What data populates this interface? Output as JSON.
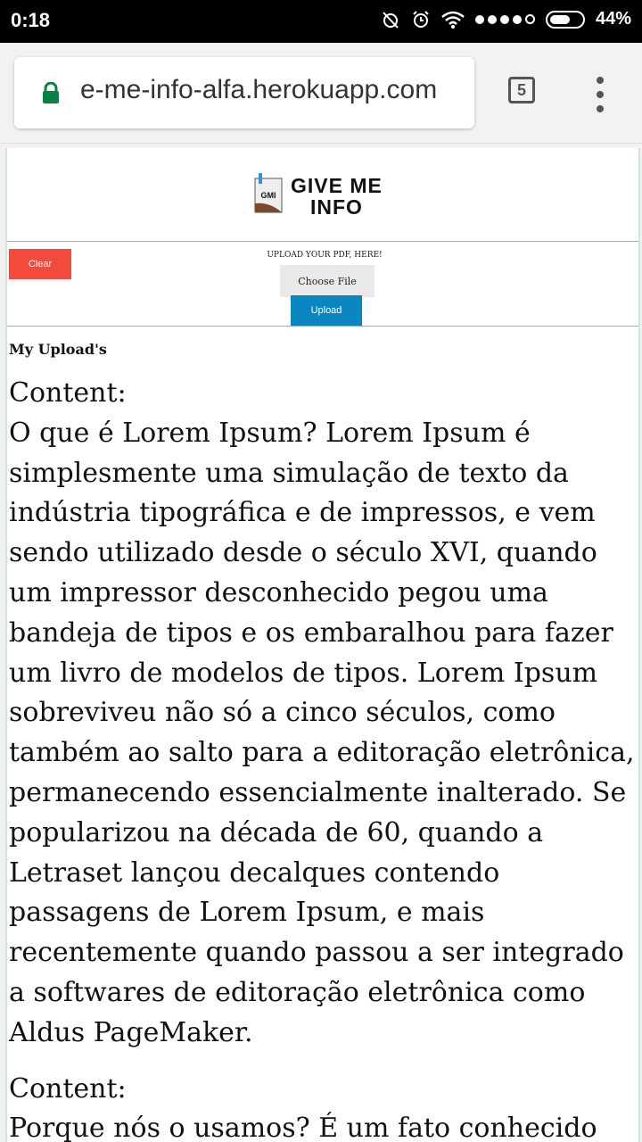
{
  "status_bar": {
    "time": "0:18",
    "battery": "44%"
  },
  "browser": {
    "url": "e-me-info-alfa.herokuapp.com",
    "tab_count": "5"
  },
  "logo": {
    "line1": "GIVE ME",
    "line2": "INFO",
    "badge": "GMI"
  },
  "upload": {
    "clear_label": "Clear",
    "prompt": "UPLOAD YOUR PDF, HERE!",
    "choose_label": "Choose File",
    "upload_label": "Upload"
  },
  "uploads": {
    "title": "My Upload's",
    "items": [
      {
        "label": "Content:",
        "text": "O que é Lorem Ipsum? Lorem Ipsum é simplesmente uma simulação de texto da indústria tipográfica e de impressos, e vem sendo utilizado desde o século XVI, quando um impressor desconhecido pegou uma bandeja de tipos e os embaralhou para fazer um livro de modelos de tipos. Lorem Ipsum sobreviveu não só a cinco séculos, como também ao salto para a editoração eletrônica, permanecendo essencialmente inalterado. Se popularizou na década de 60, quando a Letraset lançou decalques contendo passagens de Lorem Ipsum, e mais recentemente quando passou a ser integrado a softwares de editoração eletrônica como Aldus PageMaker."
      },
      {
        "label": "Content:",
        "text": "Porque nós o usamos? É um fato conhecido"
      }
    ]
  }
}
